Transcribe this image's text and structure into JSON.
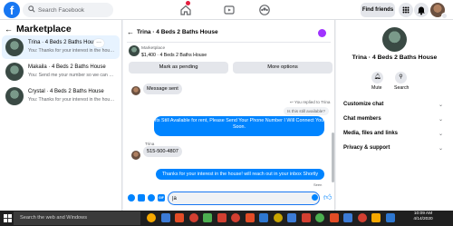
{
  "topbar": {
    "logo": "f",
    "search_placeholder": "Search Facebook",
    "find_friends": "Find friends",
    "icons": [
      "home-icon",
      "video-icon",
      "groups-icon",
      "menu-icon",
      "messenger-icon",
      "notifications-icon"
    ]
  },
  "sidebar": {
    "title": "Marketplace",
    "conversations": [
      {
        "title": "Trina · 4 Beds 2 Baths House",
        "subtitle": "You: Thanks for your interest in the house! ...",
        "active": true
      },
      {
        "title": "Makaila · 4 Beds 2 Baths House",
        "subtitle": "You: Send me your number so we can chat ...",
        "active": false
      },
      {
        "title": "Crystal · 4 Beds 2 Baths House",
        "subtitle": "You: Thanks for your interest in the house! ...",
        "active": false
      }
    ]
  },
  "chat": {
    "title": "Trina · 4 Beds 2 Baths House",
    "marketplace_label": "Marketplace",
    "listing": "$1,400 · 4 Beds 2 Baths House",
    "mark_pending": "Mark as pending",
    "more_options": "More options",
    "messages": {
      "incoming_1": "Message sent",
      "replied_meta": "You replied to Trina",
      "replied_quote": "Is this still available?",
      "outgoing_1": "Its Still Available for rent, Please Send Your Phone Number I Will Connect You Soon.",
      "sender_name": "Trina",
      "incoming_2": "515-500-4807",
      "outgoing_2": "Thanks for your interest in the house! will reach out in your inbox Shortly",
      "seen": "Seen"
    },
    "composer_value": "|a"
  },
  "right_panel": {
    "name": "Trina · 4 Beds 2 Baths House",
    "actions": [
      {
        "label": "Mute",
        "icon": "bell-icon"
      },
      {
        "label": "Search",
        "icon": "search-icon"
      }
    ],
    "sections": [
      "Customize chat",
      "Chat members",
      "Media, files and links",
      "Privacy & support"
    ]
  },
  "taskbar": {
    "search_placeholder": "Search the web and Windows",
    "time": "10:09 AM",
    "date": "4/14/2020",
    "app_colors": [
      "#f6a800",
      "#3c7bd6",
      "#e34c26",
      "#d23f31",
      "#4caf50",
      "#d23f31",
      "#d23f31",
      "#e34c26",
      "#2e77d0",
      "#c8a400",
      "#3c7bd6",
      "#d23f31",
      "#4caf50",
      "#e34c26",
      "#3c7bd6",
      "#d23f31",
      "#f6a800",
      "#2e77d0"
    ]
  },
  "colors": {
    "accent": "#1877f2",
    "outgoing_bubble": "#0084ff",
    "badge": "#e41e3f",
    "info": "#a033ff"
  }
}
